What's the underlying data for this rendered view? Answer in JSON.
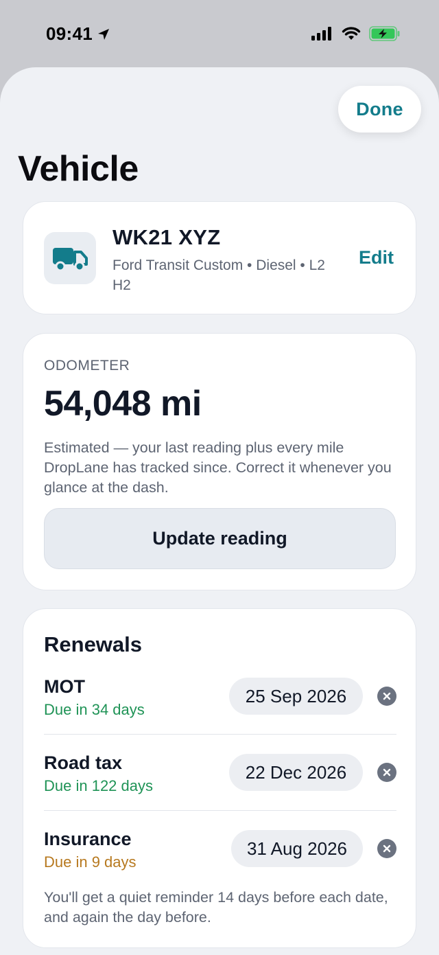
{
  "status_bar": {
    "time": "09:41",
    "icons": [
      "location-arrow-icon",
      "cellular-signal-icon",
      "wifi-icon",
      "battery-charging-icon"
    ]
  },
  "header": {
    "done_label": "Done",
    "title": "Vehicle"
  },
  "vehicle": {
    "icon": "van-icon",
    "plate": "WK21 XYZ",
    "description": "Ford Transit Custom • Diesel • L2 H2",
    "edit_label": "Edit"
  },
  "odometer": {
    "label": "ODOMETER",
    "value": "54,048 mi",
    "note": "Estimated — your last reading plus every mile DropLane has tracked since. Correct it whenever you glance at the dash.",
    "update_label": "Update reading"
  },
  "renewals": {
    "title": "Renewals",
    "items": [
      {
        "name": "MOT",
        "due": "Due in 34 days",
        "date": "25 Sep 2026",
        "status": "ok"
      },
      {
        "name": "Road tax",
        "due": "Due in 122 days",
        "date": "22 Dec 2026",
        "status": "ok"
      },
      {
        "name": "Insurance",
        "due": "Due in 9 days",
        "date": "31 Aug 2026",
        "status": "soon"
      }
    ],
    "note": "You'll get a quiet reminder 14 days before each date, and again the day before."
  },
  "colors": {
    "accent": "#137c8b",
    "due_ok": "#1f9356",
    "due_soon": "#b7791f",
    "battery": "#34c759"
  }
}
